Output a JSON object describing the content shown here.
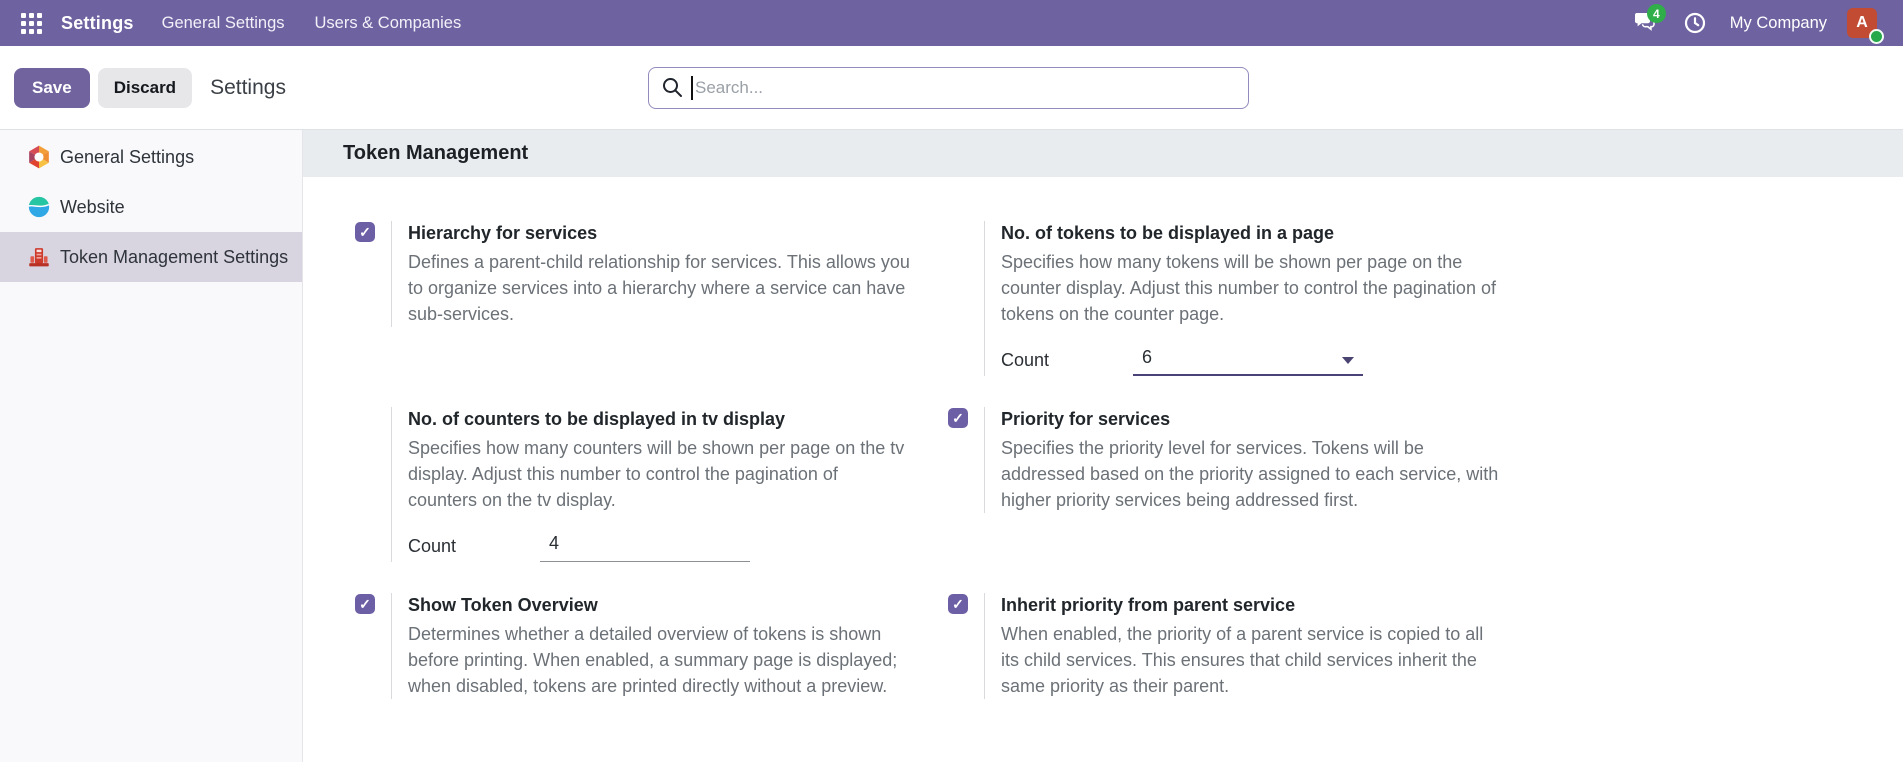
{
  "nav": {
    "brand": "Settings",
    "items": [
      {
        "label": "General Settings"
      },
      {
        "label": "Users & Companies"
      }
    ],
    "messages_count": "4",
    "company": "My Company",
    "avatar_initial": "A",
    "colors": {
      "bar": "#6e62a0",
      "badge": "#2fae49",
      "avatar_bg": "#c14b33",
      "online": "#27a84a"
    }
  },
  "control_bar": {
    "save_label": "Save",
    "discard_label": "Discard",
    "page_title": "Settings",
    "search_placeholder": "Search..."
  },
  "sidebar": {
    "items": [
      {
        "label": "General Settings",
        "icon": "general-settings-icon",
        "selected": false
      },
      {
        "label": "Website",
        "icon": "website-icon",
        "selected": false
      },
      {
        "label": "Token Management Settings",
        "icon": "token-management-icon",
        "selected": true
      }
    ]
  },
  "main": {
    "section_title": "Token Management",
    "settings": [
      {
        "title": "Hierarchy for services",
        "checked": true,
        "description": "Defines a parent-child relationship for services. This allows you to organize services into a hierarchy where a service can have sub-services."
      },
      {
        "title": "No. of tokens to be displayed in a page",
        "checked": null,
        "description": "Specifies how many tokens will be shown per page on the counter display. Adjust this number to control the pagination of tokens on the counter page.",
        "field": {
          "label": "Count",
          "value": "6",
          "type": "select"
        }
      },
      {
        "title": "No. of counters to be displayed in tv display",
        "checked": null,
        "description": "Specifies how many counters will be shown per page on the tv display. Adjust this number to control the pagination of counters on the tv display.",
        "field": {
          "label": "Count",
          "value": "4",
          "type": "input"
        }
      },
      {
        "title": "Priority for services",
        "checked": true,
        "description": "Specifies the priority level for services. Tokens will be addressed based on the priority assigned to each service, with higher priority services being addressed first."
      },
      {
        "title": "Show Token Overview",
        "checked": true,
        "description": "Determines whether a detailed overview of tokens is shown before printing. When enabled, a summary page is displayed; when disabled, tokens are printed directly without a preview."
      },
      {
        "title": "Inherit priority from parent service",
        "checked": true,
        "description": "When enabled, the priority of a parent service is copied to all its child services. This ensures that child services inherit the same priority as their parent."
      }
    ]
  },
  "colors": {
    "accent": "#6d5fa5",
    "band_bg": "#e9ecef",
    "selected_item_bg": "#d8d4e0"
  }
}
